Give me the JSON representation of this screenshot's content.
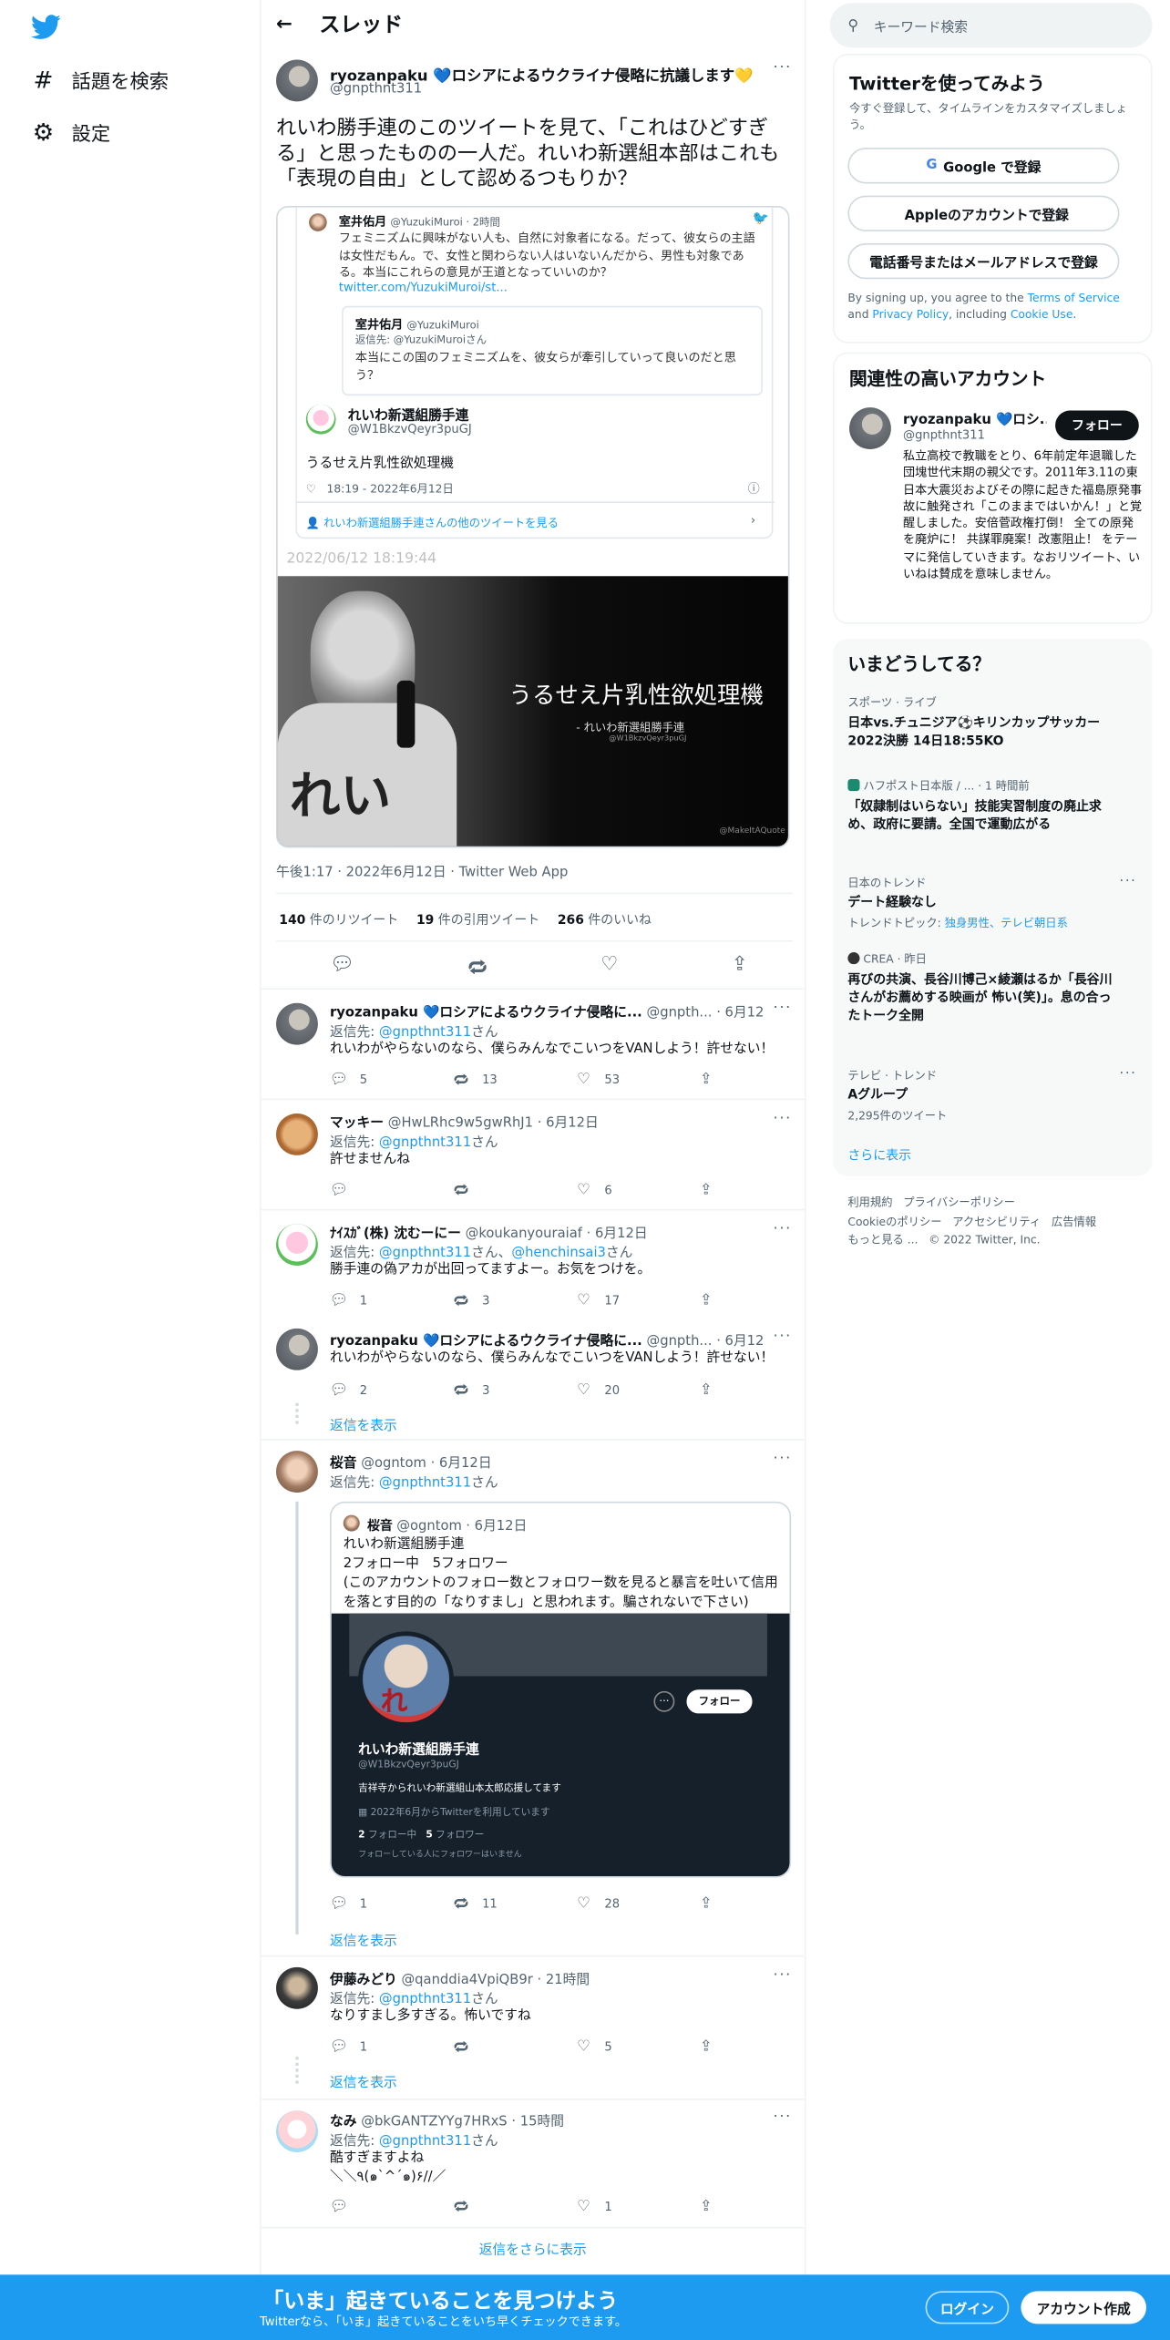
{
  "nav": {
    "explore": "話題を検索",
    "settings": "設定"
  },
  "header": {
    "title": "スレッド"
  },
  "main_tweet": {
    "name": "ryozanpaku 💙ロシアによるウクライナ侵略に抗議します💛",
    "handle": "@gnpthnt311",
    "text": "れいわ勝手連のこのツイートを見て、「これはひどすぎる」と思ったものの一人だ。れいわ新選組本部はこれも「表現の自由」として認めるつもりか？",
    "embedded": {
      "orig_name": "室井佑月",
      "orig_handle": "@YuzukiMuroi · 2時間",
      "orig_text": "フェミニズムに興味がない人も、自然に対象者になる。だって、彼女らの主語は女性だもん。で、女性と関わらない人はいないんだから、男性も対象である。本当にこれらの意見が王道となっていいのか？",
      "orig_link": "twitter.com/YuzukiMuroi/st...",
      "quote_name": "室井佑月",
      "quote_handle": "@YuzukiMuroi",
      "quote_reply": "返信先: @YuzukiMuroiさん",
      "quote_text": "本当にこの国のフェミニズムを、彼女らが牽引していって良いのだと思う？",
      "rt_name": "れいわ新選組勝手連",
      "rt_handle": "@W1BkzvQeyr3puGJ",
      "rt_text": "うるせえ片乳性欲処理機",
      "rt_time": "18:19 - 2022年6月12日",
      "rt_more": "れいわ新選組勝手連さんの他のツイートを見る",
      "stamp": "2022/06/12 18:19:44",
      "image_caption": "うるせえ片乳性欲処理機",
      "image_sub": "- れいわ新選組勝手連",
      "image_sub2": "@W1BkzvQeyr3puGJ",
      "watermark": "@MakeItAQuote",
      "sign_text": "れい"
    },
    "meta": "午後1:17 · 2022年6月12日 · Twitter Web App",
    "stats": {
      "rt_count": "140",
      "rt_label": "件のリツイート",
      "quote_count": "19",
      "quote_label": "件の引用ツイート",
      "like_count": "266",
      "like_label": "件のいいね"
    }
  },
  "replies": [
    {
      "name": "ryozanpaku 💙ロシアによるウクライナ侵略に...",
      "handle": "@gnpth...",
      "date": "· 6月12日",
      "reply_to": "@gnpthnt311",
      "reply_suffix": "さん",
      "text": "れいわがやらないのなら、僕らみんなでこいつをVANしよう！許せない！",
      "reply": "5",
      "rt": "13",
      "like": "53"
    },
    {
      "name": "マッキー",
      "handle": "@HwLRhc9w5gwRhJ1",
      "date": "· 6月12日",
      "reply_to": "@gnpthnt311",
      "reply_suffix": "さん",
      "text": "許せませんね",
      "reply": "",
      "rt": "",
      "like": "6"
    },
    {
      "name": "ﾅｲｽｶﾞ(株) 沈むーにー",
      "handle": "@koukanyouraiaf",
      "date": "· 6月12日",
      "reply_to": "@gnpthnt311",
      "reply_mid": "さん、",
      "reply_to2": "@henchinsai3",
      "reply_suffix": "さん",
      "text": "勝手連の偽アカが出回ってますよー。お気をつけを。",
      "reply": "1",
      "rt": "3",
      "like": "17"
    },
    {
      "name": "ryozanpaku 💙ロシアによるウクライナ侵略に...",
      "handle": "@gnpth...",
      "date": "· 6月12日",
      "text": "れいわがやらないのなら、僕らみんなでこいつをVANしよう！許せない！",
      "reply": "2",
      "rt": "3",
      "like": "20",
      "show_replies": "返信を表示"
    },
    {
      "name": "桜音",
      "handle": "@ogntom",
      "date": "· 6月12日",
      "reply_to": "@gnpthnt311",
      "reply_suffix": "さん",
      "reply": "1",
      "rt": "11",
      "like": "28",
      "show_replies": "返信を表示",
      "quote": {
        "name": "桜音",
        "handle": "@ogntom",
        "date": "· 6月12日",
        "line1": "れいわ新選組勝手連",
        "line2": "2フォロー中　5フォロワー",
        "line3": "(このアカウントのフォロー数とフォロワー数を見ると暴言を吐いて信用を落とす目的の「なりすまし」と思われます。騙されないで下さい)",
        "profile_name": "れいわ新選組勝手連",
        "profile_handle": "@W1BkzvQeyr3puGJ",
        "profile_bio": "吉祥寺かられいわ新選組山本太郎応援してます",
        "profile_joined": "2022年6月からTwitterを利用しています",
        "profile_following": "2",
        "profile_following_label": "フォロー中",
        "profile_followers": "5",
        "profile_followers_label": "フォロワー",
        "profile_note": "フォローしている人にフォロワーはいません",
        "follow_btn": "フォロー",
        "avatar_text": "れ"
      }
    },
    {
      "name": "伊藤みどり",
      "handle": "@qanddia4VpiQB9r",
      "date": "· 21時間",
      "reply_to": "@gnpthnt311",
      "reply_suffix": "さん",
      "text": "なりすまし多すぎる。怖いですね",
      "reply": "1",
      "rt": "",
      "like": "5",
      "show_replies": "返信を表示"
    },
    {
      "name": "なみ",
      "handle": "@bkGANTZYYg7HRxS",
      "date": "· 15時間",
      "reply_to": "@gnpthnt311",
      "reply_suffix": "さん",
      "text": "酷すぎますよね",
      "text2": "＼＼٩(๑`^´๑)۶//／",
      "reply": "",
      "rt": "",
      "like": "1"
    }
  ],
  "reply_prefix": "返信先: ",
  "more_replies": "返信をさらに表示",
  "right": {
    "search_placeholder": "キーワード検索",
    "signup": {
      "title": "Twitterを使ってみよう",
      "subtitle": "今すぐ登録して、タイムラインをカスタマイズしましょう。",
      "google": "Google で登録",
      "apple": "Appleのアカウントで登録",
      "phone": "電話番号またはメールアドレスで登録",
      "terms_pre": "By signing up, you agree to the ",
      "terms": "Terms of Service",
      "terms_and": " and ",
      "privacy": "Privacy Policy",
      "terms_inc": ", including ",
      "cookie": "Cookie Use",
      "terms_end": "."
    },
    "relevant": {
      "title": "関連性の高いアカウント",
      "name": "ryozanpaku 💙ロシ...",
      "handle": "@gnpthnt311",
      "follow": "フォロー",
      "bio": "私立高校で教職をとり、6年前定年退職した団塊世代末期の親父です。2011年3.11の東日本大震災およびその際に起きた福島原発事故に触発され「このままではいかん！」と覚醒しました。安倍菅政権打倒！ 全ての原発を廃炉に！ 共謀罪廃案！改憲阻止！ をテーマに発信していきます。なおリツイート、いいねは賛成を意味しません。"
    },
    "trends": {
      "title": "いまどうしてる？",
      "items": [
        {
          "context": "スポーツ · ライブ",
          "title": "日本vs.チュニジア⚽キリンカップサッカー2022決勝 14日18:55KO"
        },
        {
          "context": "ハフポスト日本版 / ... · 1 時間前",
          "title": "「奴隷制はいらない」技能実習制度の廃止求め、政府に要請。全国で運動広がる"
        },
        {
          "context": "日本のトレンド",
          "title": "デート経験なし",
          "sub_pre": "トレンドトピック: ",
          "sub_link": "独身男性、テレビ朝日系"
        },
        {
          "context": "CREA · 昨日",
          "title": "再びの共演、長谷川博己×綾瀬はるか「長谷川さんがお薦めする映画が 怖い(笑)」。息の合ったトーク全開"
        },
        {
          "context": "テレビ · トレンド",
          "title": "Aグループ",
          "sub": "2,295件のツイート"
        }
      ],
      "show_more": "さらに表示"
    },
    "footer": {
      "l1a": "利用規約",
      "l1b": "プライバシーポリシー",
      "l2a": "Cookieのポリシー",
      "l2b": "アクセシビリティ",
      "l2c": "広告情報",
      "l3a": "もっと見る ...",
      "l3b": "© 2022 Twitter, Inc."
    }
  },
  "bottom": {
    "title": "「いま」起きていることを見つけよう",
    "subtitle": "Twitterなら、「いま」起きていることをいち早くチェックできます。",
    "login": "ログイン",
    "signup": "アカウント作成"
  }
}
